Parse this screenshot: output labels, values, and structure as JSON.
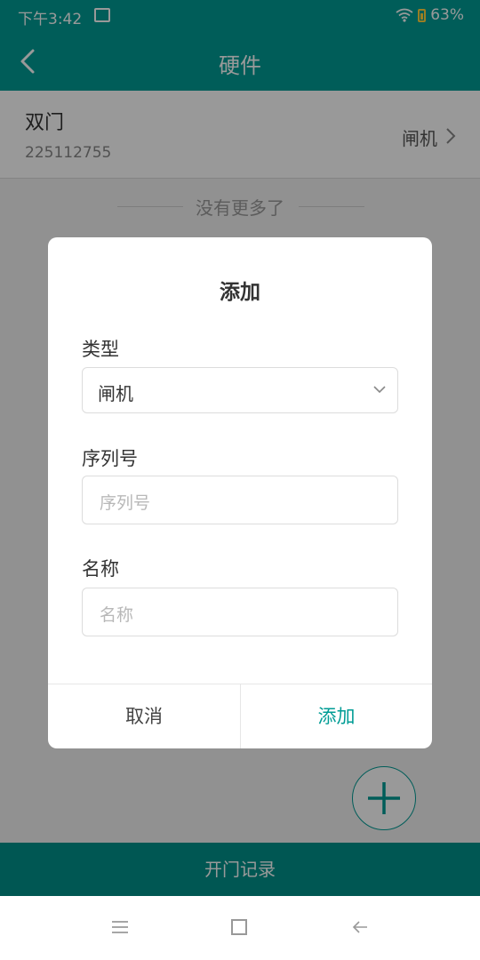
{
  "status_bar": {
    "time": "下午3:42",
    "battery": "63%"
  },
  "header": {
    "title": "硬件"
  },
  "device": {
    "name": "双门",
    "serial": "225112755",
    "type": "闸机"
  },
  "list_footer": "没有更多了",
  "bottom_button": "开门记录",
  "dialog": {
    "title": "添加",
    "type_label": "类型",
    "type_value": "闸机",
    "serial_label": "序列号",
    "serial_placeholder": "序列号",
    "name_label": "名称",
    "name_placeholder": "名称",
    "cancel": "取消",
    "confirm": "添加"
  },
  "colors": {
    "primary": "#009c95",
    "overlay": "rgba(0,0,0,0.4)"
  },
  "icons": [
    "image-icon",
    "wifi-icon",
    "battery-icon",
    "back-arrow-icon",
    "chevron-right-icon",
    "chevron-down-icon",
    "plus-icon",
    "menu-icon",
    "home-icon",
    "back-icon"
  ]
}
